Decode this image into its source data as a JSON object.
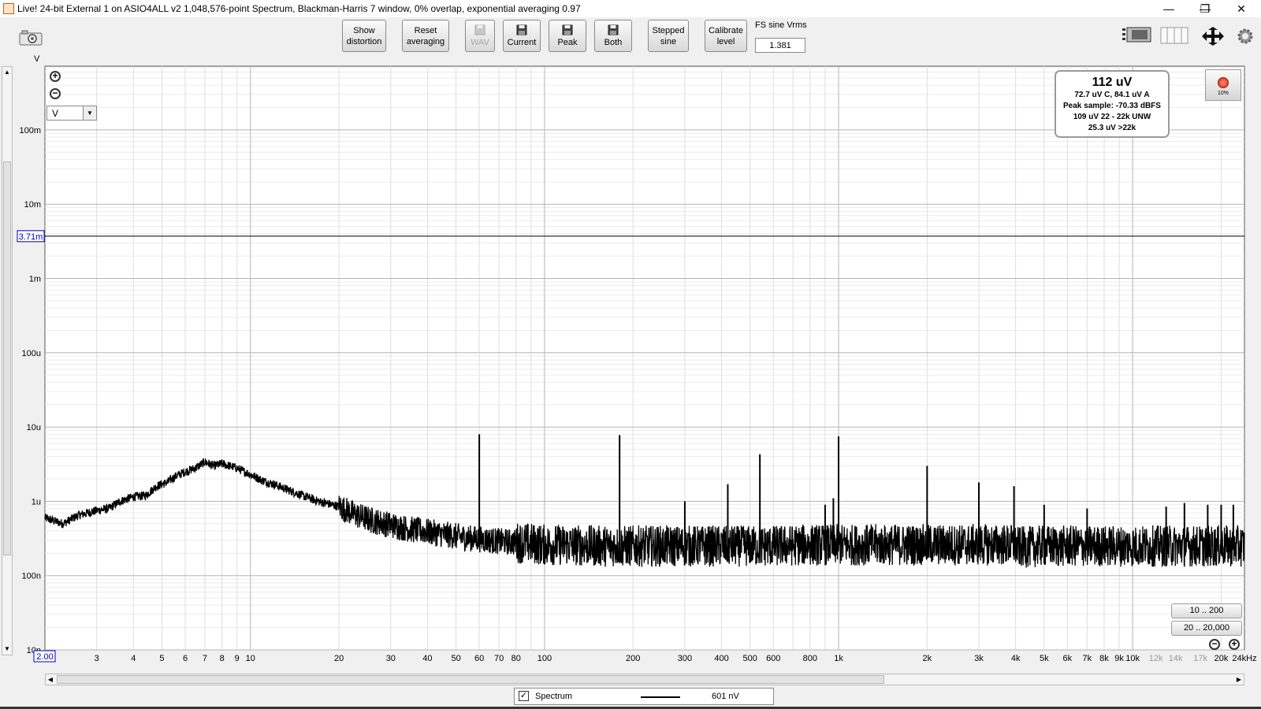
{
  "window": {
    "title": "Live! 24-bit External 1 on ASIO4ALL v2 1,048,576-point Spectrum, Blackman-Harris 7 window, 0% overlap, exponential averaging 0.97",
    "minimize": "—",
    "restore": "❐",
    "close": "✕"
  },
  "toolbar": {
    "show_distortion": [
      "Show",
      "distortion"
    ],
    "reset_averaging": [
      "Reset",
      "averaging"
    ],
    "wav": "WAV",
    "current": "Current",
    "peak": "Peak",
    "both": "Both",
    "stepped_sine": [
      "Stepped",
      "sine"
    ],
    "calibrate_level": [
      "Calibrate",
      "level"
    ],
    "fs_label": "FS sine Vrms",
    "fs_value": "1.381"
  },
  "graph": {
    "y_unit": "V",
    "unit_select": "V",
    "cursor_y_label": "3.71m",
    "x_start_label": "2.00",
    "level": {
      "main": "112 uV",
      "lines": [
        "72.7 uV C, 84.1 uV A",
        "Peak sample: -70.33 dBFS",
        "109 uV 22 - 22k UNW",
        "25.3 uV >22k"
      ]
    },
    "record_pct": "10%",
    "zoom_presets": [
      "10 .. 200",
      "20 .. 20,000"
    ],
    "legend": {
      "name": "Spectrum",
      "value": "601 nV"
    }
  },
  "chart_data": {
    "type": "line",
    "x_scale": "log",
    "y_scale": "log",
    "xlim": [
      2,
      24000
    ],
    "ylim": [
      1e-08,
      1
    ],
    "y_ticks": [
      {
        "v": 0.1,
        "label": "100m"
      },
      {
        "v": 0.01,
        "label": "10m"
      },
      {
        "v": 0.001,
        "label": "1m"
      },
      {
        "v": 0.0001,
        "label": "100u"
      },
      {
        "v": 1e-05,
        "label": "10u"
      },
      {
        "v": 1e-06,
        "label": "1u"
      },
      {
        "v": 1e-07,
        "label": "100n"
      },
      {
        "v": 1e-08,
        "label": "10n"
      }
    ],
    "x_ticks": [
      {
        "v": 3,
        "label": "3"
      },
      {
        "v": 4,
        "label": "4"
      },
      {
        "v": 5,
        "label": "5"
      },
      {
        "v": 6,
        "label": "6"
      },
      {
        "v": 7,
        "label": "7"
      },
      {
        "v": 8,
        "label": "8"
      },
      {
        "v": 9,
        "label": "9"
      },
      {
        "v": 10,
        "label": "10"
      },
      {
        "v": 20,
        "label": "20"
      },
      {
        "v": 30,
        "label": "30"
      },
      {
        "v": 40,
        "label": "40"
      },
      {
        "v": 50,
        "label": "50"
      },
      {
        "v": 60,
        "label": "60"
      },
      {
        "v": 70,
        "label": "70"
      },
      {
        "v": 80,
        "label": "80"
      },
      {
        "v": 100,
        "label": "100"
      },
      {
        "v": 200,
        "label": "200"
      },
      {
        "v": 300,
        "label": "300"
      },
      {
        "v": 400,
        "label": "400"
      },
      {
        "v": 500,
        "label": "500"
      },
      {
        "v": 600,
        "label": "600"
      },
      {
        "v": 800,
        "label": "800"
      },
      {
        "v": 1000,
        "label": "1k"
      },
      {
        "v": 2000,
        "label": "2k"
      },
      {
        "v": 3000,
        "label": "3k"
      },
      {
        "v": 4000,
        "label": "4k"
      },
      {
        "v": 5000,
        "label": "5k"
      },
      {
        "v": 6000,
        "label": "6k"
      },
      {
        "v": 7000,
        "label": "7k"
      },
      {
        "v": 8000,
        "label": "8k"
      },
      {
        "v": 9000,
        "label": "9k"
      },
      {
        "v": 10000,
        "label": "10k"
      },
      {
        "v": 12000,
        "label": "12k",
        "muted": true
      },
      {
        "v": 14000,
        "label": "14k",
        "muted": true
      },
      {
        "v": 17000,
        "label": "17k",
        "muted": true
      },
      {
        "v": 20000,
        "label": "20k"
      },
      {
        "v": 24000,
        "label": "24kHz"
      }
    ],
    "cursor_level": 0.00371,
    "series": [
      {
        "name": "Spectrum",
        "color": "#000000",
        "x": [
          2.0,
          2.3,
          2.6,
          3.0,
          3.3,
          3.6,
          4.0,
          4.4,
          4.8,
          5.2,
          5.6,
          6.0,
          6.5,
          7.0,
          7.5,
          8.0,
          8.5,
          9.0,
          10,
          11,
          12,
          13,
          15,
          17,
          20,
          23,
          26,
          30,
          35,
          40,
          45,
          50,
          55,
          60,
          70,
          80,
          90,
          100,
          120,
          150,
          200,
          250,
          300,
          400,
          500,
          600,
          800,
          1000,
          1500,
          2000,
          3000,
          3900,
          4100,
          5000,
          7000,
          10000,
          15000,
          20000,
          24000
        ],
        "y": [
          6e-07,
          5e-07,
          6.5e-07,
          7.5e-07,
          8e-07,
          1e-06,
          1.15e-06,
          1.2e-06,
          1.6e-06,
          1.8e-06,
          2.2e-06,
          2.5e-06,
          2.8e-06,
          3.4e-06,
          3e-06,
          3.2e-06,
          3e-06,
          2.8e-06,
          2.3e-06,
          1.9e-06,
          1.7e-06,
          1.5e-06,
          1.2e-06,
          1e-06,
          8.5e-07,
          6.5e-07,
          5.5e-07,
          4.8e-07,
          4.2e-07,
          3.9e-07,
          3.6e-07,
          3.4e-07,
          3.2e-07,
          3.1e-07,
          2.9e-07,
          2.8e-07,
          2.7e-07,
          2.6e-07,
          2.6e-07,
          2.5e-07,
          2.5e-07,
          2.5e-07,
          2.5e-07,
          2.5e-07,
          2.5e-07,
          2.5e-07,
          2.6e-07,
          2.6e-07,
          2.6e-07,
          2.6e-07,
          2.6e-07,
          2.6e-07,
          2.4e-07,
          2.5e-07,
          2.5e-07,
          2.5e-07,
          2.5e-07,
          2.5e-07,
          2.5e-07
        ]
      }
    ],
    "peaks": [
      {
        "x": 60,
        "y": 8e-06
      },
      {
        "x": 180,
        "y": 7.8e-06
      },
      {
        "x": 300,
        "y": 1e-06
      },
      {
        "x": 420,
        "y": 1.7e-06
      },
      {
        "x": 540,
        "y": 4.3e-06
      },
      {
        "x": 900,
        "y": 9e-07
      },
      {
        "x": 960,
        "y": 1.1e-06
      },
      {
        "x": 1000,
        "y": 7.5e-06
      },
      {
        "x": 2000,
        "y": 3e-06
      },
      {
        "x": 3000,
        "y": 1.8e-06
      },
      {
        "x": 3950,
        "y": 1.6e-06
      },
      {
        "x": 5000,
        "y": 9e-07
      },
      {
        "x": 7000,
        "y": 8e-07
      },
      {
        "x": 13000,
        "y": 8.5e-07
      },
      {
        "x": 15000,
        "y": 9.5e-07
      },
      {
        "x": 18000,
        "y": 9e-07
      },
      {
        "x": 20000,
        "y": 9e-07
      },
      {
        "x": 22000,
        "y": 9e-07
      }
    ]
  }
}
